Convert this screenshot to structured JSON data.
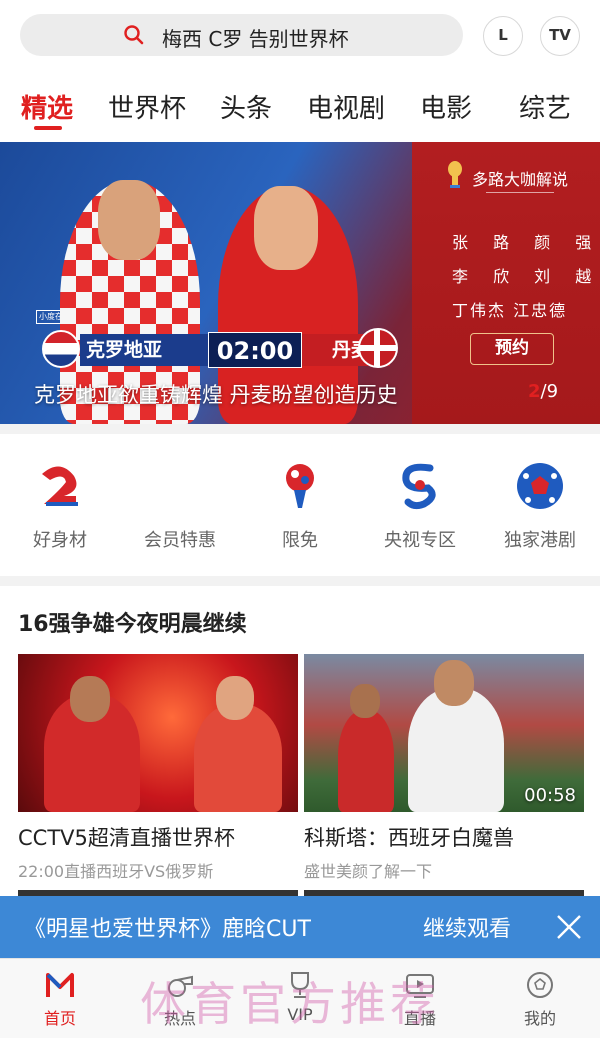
{
  "search": {
    "placeholder_text": "梅西 C罗 告别世界杯"
  },
  "header_buttons": {
    "history_label": "L",
    "tv_label": "TV"
  },
  "tabs": [
    {
      "label": "精选",
      "active": true
    },
    {
      "label": "世界杯"
    },
    {
      "label": "头条"
    },
    {
      "label": "电视剧"
    },
    {
      "label": "电影"
    },
    {
      "label": "综艺"
    }
  ],
  "banner": {
    "brand_badge": "小度在家",
    "panel_title": "多路大咖解说",
    "commentators": [
      "张 路 颜 强",
      "李 欣 刘 越",
      "丁伟杰 江忠德"
    ],
    "book_button": "预约",
    "team_left": "克罗地亚",
    "match_time": "02:00",
    "team_right": "丹麦",
    "caption": "克罗地亚欲重铸辉煌 丹麦盼望创造历史",
    "pager_current": "2",
    "pager_total": "/9"
  },
  "shortcuts": [
    {
      "label": "好身材",
      "icon": "haoshencai-icon"
    },
    {
      "label": "会员特惠",
      "icon": "vip-deal-icon"
    },
    {
      "label": "限免",
      "icon": "world-cup-icon"
    },
    {
      "label": "央视专区",
      "icon": "cctv-icon"
    },
    {
      "label": "独家港剧",
      "icon": "soccer-ball-icon"
    }
  ],
  "section": {
    "title": "16强争雄今夜明晨继续",
    "cards": [
      {
        "title": "CCTV5超清直播世界杯",
        "subtitle": "22:00直播西班牙VS俄罗斯",
        "duration": ""
      },
      {
        "title": "科斯塔：西班牙白魔兽",
        "subtitle": "盛世美颜了解一下",
        "duration": "00:58"
      }
    ]
  },
  "continue_bar": {
    "title": "《明星也爱世界杯》鹿晗CUT",
    "button": "继续观看"
  },
  "bottom_nav": [
    {
      "label": "首页",
      "icon": "home-icon",
      "active": true
    },
    {
      "label": "热点",
      "icon": "whistle-icon"
    },
    {
      "label": "VIP",
      "icon": "trophy-icon"
    },
    {
      "label": "直播",
      "icon": "live-tv-icon"
    },
    {
      "label": "我的",
      "icon": "profile-ball-icon"
    }
  ],
  "watermark": "体育官方推荐",
  "colors": {
    "accent": "#e02020",
    "continue_bar": "#3d88d6",
    "banner_panel": "#b21e20"
  }
}
